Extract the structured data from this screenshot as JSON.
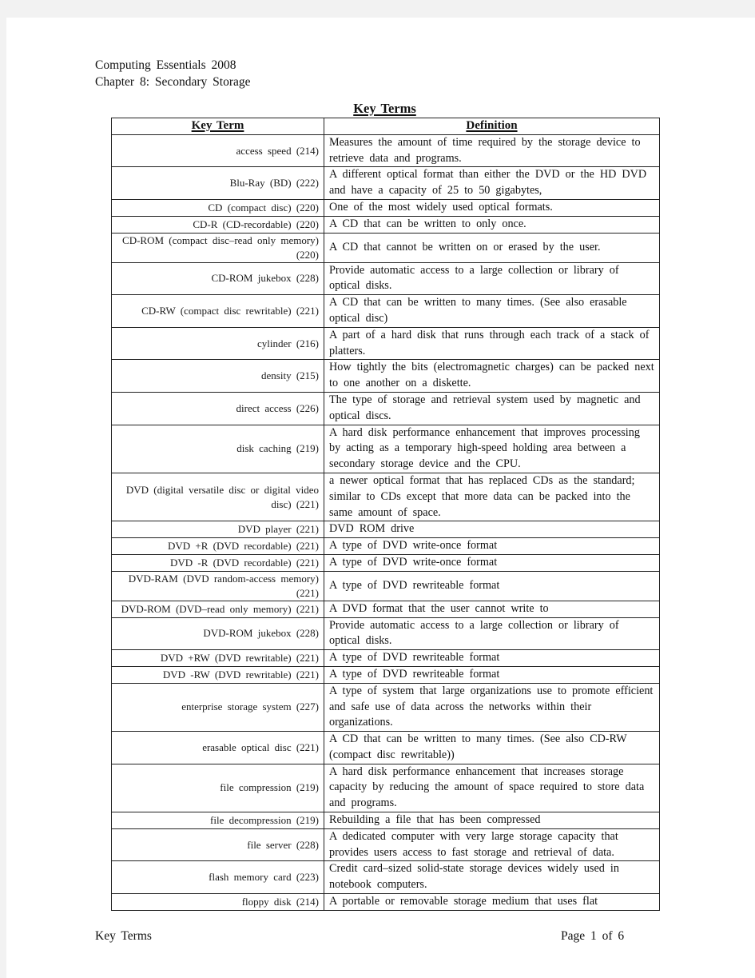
{
  "header": {
    "book_title": "Computing Essentials 2008",
    "chapter": "Chapter 8: Secondary Storage"
  },
  "document": {
    "title": "Key Terms"
  },
  "table": {
    "columns": [
      "Key Term",
      "Definition"
    ],
    "rows": [
      {
        "term": "access speed (214)",
        "definition": "Measures the amount of time required by the storage device to retrieve data and programs."
      },
      {
        "term": "Blu-Ray (BD) (222)",
        "definition": "A different optical format than either the DVD or the HD DVD and have a capacity of 25 to 50 gigabytes,"
      },
      {
        "term": "CD (compact disc) (220)",
        "definition": "One of the most widely used optical formats."
      },
      {
        "term": "CD-R (CD-recordable) (220)",
        "definition": "A CD that can be written to only once."
      },
      {
        "term": "CD-ROM (compact disc–read only memory) (220)",
        "definition": "A CD that cannot be written on or erased by the user."
      },
      {
        "term": "CD-ROM jukebox (228)",
        "definition": "Provide automatic access to a large collection or library of optical disks."
      },
      {
        "term": "CD-RW (compact disc rewritable) (221)",
        "definition": "A CD that can be written to many times.  (See also erasable optical disc)"
      },
      {
        "term": "cylinder (216)",
        "definition": "A part of a hard disk that runs through each track of a stack of platters."
      },
      {
        "term": "density (215)",
        "definition": "How tightly the bits (electromagnetic charges) can be packed next to one another on a diskette."
      },
      {
        "term": "direct access (226)",
        "definition": "The type of storage and retrieval system used by magnetic and optical discs."
      },
      {
        "term": "disk caching (219)",
        "definition": "A hard disk performance enhancement that improves processing by acting as a temporary high-speed holding area between a secondary storage device and the CPU."
      },
      {
        "term": "DVD (digital versatile disc or digital video disc) (221)",
        "definition": "a newer optical format that has replaced CDs as the standard; similar to CDs except that more data can be packed into the same amount of space."
      },
      {
        "term": "DVD player (221)",
        "definition": "DVD ROM drive"
      },
      {
        "term": "DVD +R (DVD recordable) (221)",
        "definition": "A type of DVD write-once format"
      },
      {
        "term": "DVD -R (DVD recordable) (221)",
        "definition": "A type of DVD write-once format"
      },
      {
        "term": "DVD-RAM (DVD random-access memory) (221)",
        "definition": "A type of DVD rewriteable format"
      },
      {
        "term": "DVD-ROM (DVD–read only memory) (221)",
        "definition": "A DVD format that the user cannot write to"
      },
      {
        "term": "DVD-ROM jukebox (228)",
        "definition": "Provide automatic access to a large collection or library of optical disks."
      },
      {
        "term": "DVD +RW (DVD rewritable) (221)",
        "definition": "A type of DVD rewriteable format"
      },
      {
        "term": "DVD -RW (DVD rewritable) (221)",
        "definition": "A type of DVD rewriteable format"
      },
      {
        "term": "enterprise storage system (227)",
        "definition": "A type of system that large organizations use to promote efficient and safe use of data across the networks within their organizations."
      },
      {
        "term": "erasable optical disc (221)",
        "definition": "A CD that can be written to many times.  (See also CD-RW (compact disc rewritable))"
      },
      {
        "term": "file compression (219)",
        "definition": "A hard disk performance enhancement that increases storage capacity by reducing the amount of space required to store data and programs."
      },
      {
        "term": "file decompression (219)",
        "definition": "Rebuilding a file that has been compressed"
      },
      {
        "term": "file server (228)",
        "definition": "A dedicated computer with very large storage capacity that provides users access to fast storage and retrieval of data."
      },
      {
        "term": "flash memory card (223)",
        "definition": "Credit card–sized solid-state storage devices widely used in notebook computers."
      },
      {
        "term": "floppy disk (214)",
        "definition": "A portable or removable storage medium that uses flat"
      }
    ]
  },
  "footer": {
    "left": "Key Terms",
    "right": "Page 1 of 6"
  }
}
